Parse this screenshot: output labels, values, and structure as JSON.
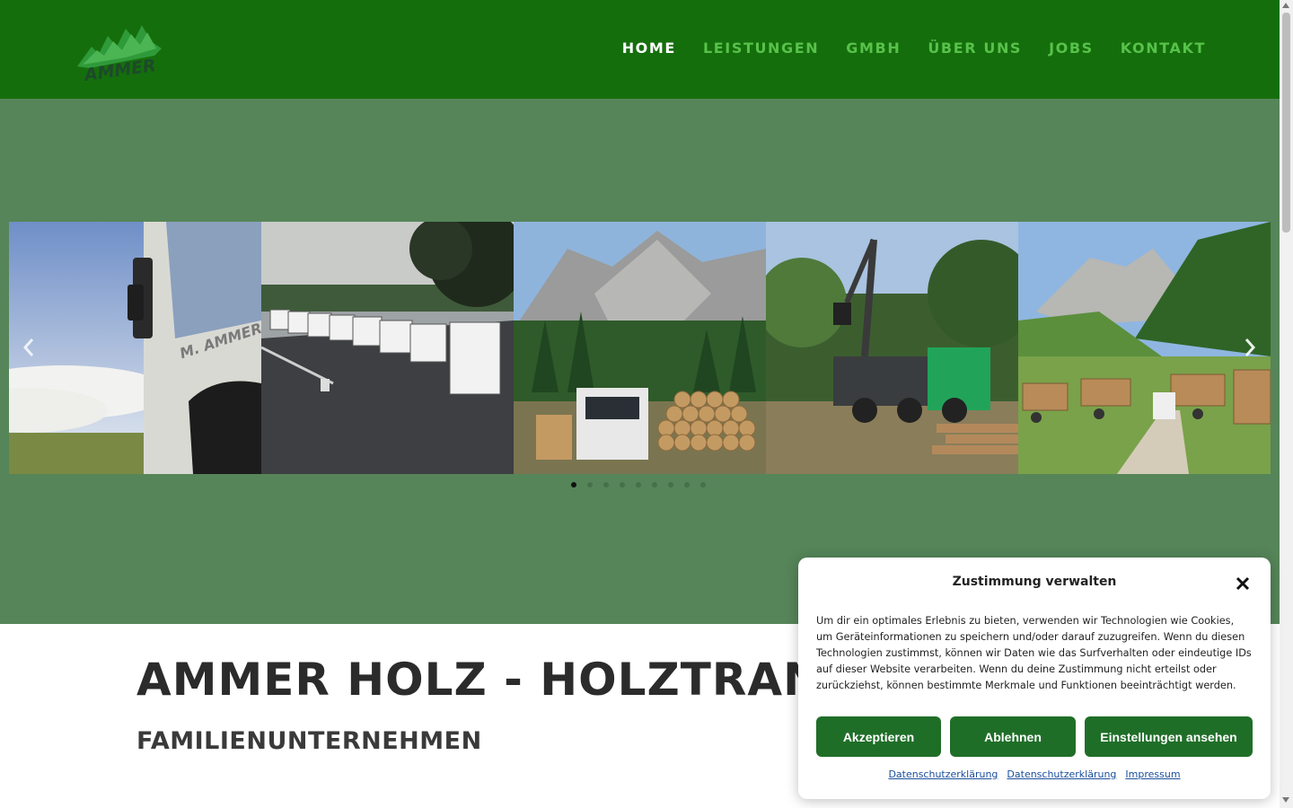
{
  "header": {
    "logo_text": "AMMER",
    "brand_color": "#156e0c",
    "nav": [
      {
        "label": "HOME",
        "active": true
      },
      {
        "label": "LEISTUNGEN",
        "active": false
      },
      {
        "label": "GMBH",
        "active": false
      },
      {
        "label": "ÜBER UNS",
        "active": false
      },
      {
        "label": "JOBS",
        "active": false
      },
      {
        "label": "KONTAKT",
        "active": false
      }
    ]
  },
  "slider": {
    "background": "#568559",
    "slides": [
      "truck-cab-above-clouds",
      "truck-fleet-parking-lot",
      "timber-truck-mountains",
      "forestry-crane-truck",
      "timber-trucks-alpine-meadow"
    ],
    "prev_icon": "chevron-left-icon",
    "next_icon": "chevron-right-icon",
    "dot_count": 9,
    "active_dot": 0
  },
  "content": {
    "title": "AMMER HOLZ - HOLZTRANSPO",
    "subtitle": "FAMILIENUNTERNEHMEN"
  },
  "cookie": {
    "title": "Zustimmung verwalten",
    "close_icon": "close-icon",
    "text": "Um dir ein optimales Erlebnis zu bieten, verwenden wir Technologien wie Cookies, um Geräteinformationen zu speichern und/oder darauf zuzugreifen. Wenn du diesen Technologien zustimmst, können wir Daten wie das Surfverhalten oder eindeutige IDs auf dieser Website verarbeiten. Wenn du deine Zustimmung nicht erteilst oder zurückziehst, können bestimmte Merkmale und Funktionen beeinträchtigt werden.",
    "accept_label": "Akzeptieren",
    "deny_label": "Ablehnen",
    "settings_label": "Einstellungen ansehen",
    "links": [
      "Datenschutzerklärung",
      "Datenschutzerklärung",
      "Impressum"
    ],
    "button_color": "#1f6e28"
  }
}
